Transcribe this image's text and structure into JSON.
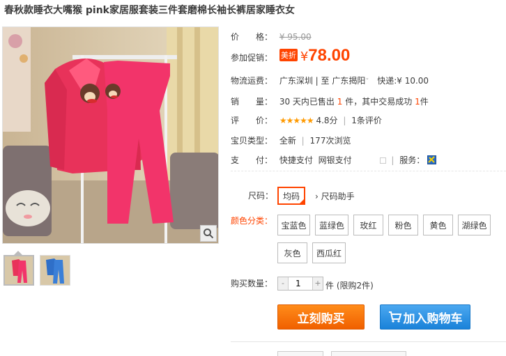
{
  "product": {
    "title": "春秋款睡衣大嘴猴 pink家居服套装三件套磨棉长袖长裤居家睡衣女"
  },
  "price": {
    "label": "价　　格：",
    "original": "¥ 95.00",
    "promo_label": "参加促销：",
    "promo_tag": "美折",
    "currency": "¥",
    "promo_price": "78.00"
  },
  "shipping": {
    "label": "物流运费：",
    "from": "广东深圳",
    "to_sep": "| 至",
    "to": "广东揭阳",
    "to_arrow": "ˇ",
    "express_label": "快递:",
    "express_price": "¥ 10.00"
  },
  "sales": {
    "label": "销　　量：",
    "text_a": "30 天内已售出",
    "sold": "1",
    "text_b": "件，其中交易成功",
    "success": "1",
    "text_c": "件"
  },
  "rating": {
    "label": "评　　价：",
    "stars": "★★★★★",
    "score": "4.8分",
    "sep": "|",
    "reviews_count": "1",
    "reviews_text": "条评价"
  },
  "type": {
    "label": "宝贝类型：",
    "value": "全新",
    "sep": "|",
    "views_count": "177",
    "views_text": "次浏览"
  },
  "payment": {
    "label": "支　　付：",
    "method1": "快捷支付",
    "method2": "网银支付",
    "sep": "|",
    "service_label": "服务："
  },
  "size": {
    "label": "尺码：",
    "option": "均码",
    "helper": "尺码助手",
    "helper_arrow": "›"
  },
  "color": {
    "label": "颜色分类：",
    "options": [
      "宝蓝色",
      "蓝绿色",
      "玫红",
      "粉色",
      "黄色",
      "湖绿色",
      "灰色",
      "西瓜红"
    ]
  },
  "quantity": {
    "label": "购买数量：",
    "value": "1",
    "minus": "-",
    "plus": "+",
    "unit": "件",
    "limit": "(限购2件)"
  },
  "actions": {
    "buy_now": "立刻购买",
    "add_to_cart": "加入购物车"
  },
  "colors": {
    "accent": "#ff4400",
    "buy_button": "#f06000",
    "cart_button": "#1a82d9",
    "stars": "#ff9a00"
  }
}
